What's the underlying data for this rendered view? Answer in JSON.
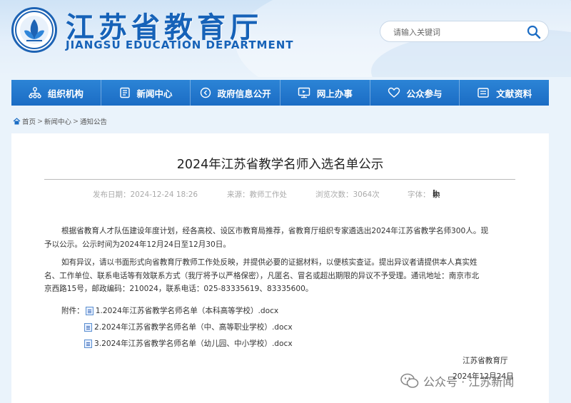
{
  "header": {
    "title": "江苏省教育厅",
    "subtitle": "JIANGSU EDUCATION DEPARTMENT",
    "search_placeholder": "请输入关键词"
  },
  "nav": [
    {
      "label": "组织机构",
      "icon": "org-chart-icon"
    },
    {
      "label": "新闻中心",
      "icon": "document-icon"
    },
    {
      "label": "政府信息公开",
      "icon": "info-circle-icon"
    },
    {
      "label": "网上办事",
      "icon": "monitor-icon"
    },
    {
      "label": "公众参与",
      "icon": "heart-icon"
    },
    {
      "label": "文献资料",
      "icon": "book-icon"
    }
  ],
  "breadcrumb": {
    "home": "首页",
    "sep": ">",
    "level1": "新闻中心",
    "level2": "通知公告"
  },
  "article": {
    "title": "2024年江苏省教学名师入选名单公示",
    "meta": {
      "date": "发布日期：2024-12-24 18:26",
      "source": "来源：教师工作处",
      "views": "浏览次数：3064次",
      "font_label": "字体：",
      "font_bracket_open": "[",
      "font_large": "大",
      "font_medium": "中",
      "font_small": "小",
      "font_bracket_close": "]"
    },
    "para1_line1": "根据省教育人才队伍建设年度计划，经各高校、设区市教育局推荐，省教育厅组织专家遴选出2024年江苏省教学名师300人。现",
    "para1_line2": "予以公示。公示时间为2024年12月24日至12月30日。",
    "para2_line1": "如有异议，请以书面形式向省教育厅教师工作处反映，并提供必要的证据材料，以便核实查证。提出异议者请提供本人真实姓",
    "para2_line2": "名、工作单位、联系电话等有效联系方式（我厅将予以严格保密），凡匿名、冒名或超出期限的异议不予受理。通讯地址：南京市北",
    "para2_line3": "京西路15号，邮政编码：210024，联系电话：025-83335619、83335600。",
    "attachments_label": "附件：",
    "attachments": [
      "1.2024年江苏省教学名师名单（本科高等学校）.docx",
      "2.2024年江苏省教学名师名单（中、高等职业学校）.docx",
      "3.2024年江苏省教学名师名单（幼儿园、中小学校）.docx"
    ],
    "signature_org": "江苏省教育厅",
    "signature_date": "2024年12月24日"
  },
  "watermark": "公众号 · 江苏新闻",
  "colors": {
    "primary": "#1b6cc4",
    "title_blue": "#1662b8",
    "background": "#eaf3fb"
  }
}
